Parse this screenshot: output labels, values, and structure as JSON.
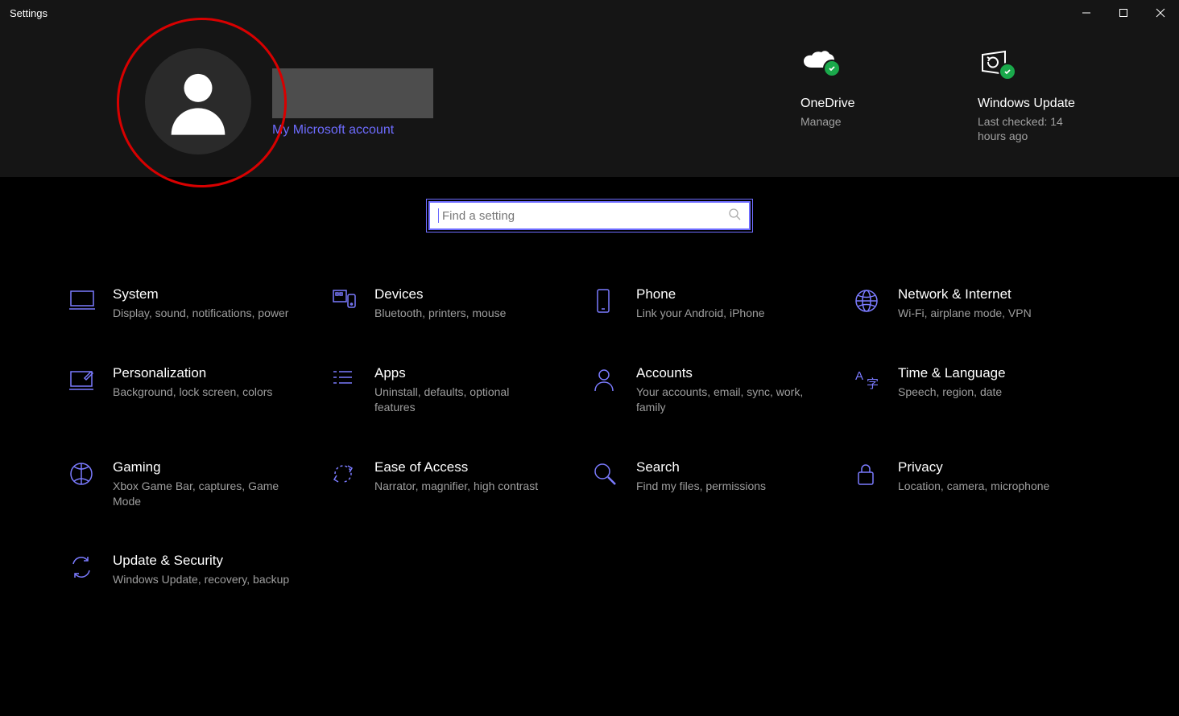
{
  "window": {
    "title": "Settings"
  },
  "profile": {
    "name_redacted": true,
    "account_link_label": "My Microsoft account"
  },
  "status": {
    "onedrive": {
      "title": "OneDrive",
      "subtitle": "Manage"
    },
    "update": {
      "title": "Windows Update",
      "subtitle": "Last checked: 14 hours ago"
    }
  },
  "search": {
    "placeholder": "Find a setting"
  },
  "categories": [
    {
      "id": "system",
      "title": "System",
      "desc": "Display, sound, notifications, power"
    },
    {
      "id": "devices",
      "title": "Devices",
      "desc": "Bluetooth, printers, mouse"
    },
    {
      "id": "phone",
      "title": "Phone",
      "desc": "Link your Android, iPhone"
    },
    {
      "id": "network",
      "title": "Network & Internet",
      "desc": "Wi-Fi, airplane mode, VPN"
    },
    {
      "id": "personalization",
      "title": "Personalization",
      "desc": "Background, lock screen, colors"
    },
    {
      "id": "apps",
      "title": "Apps",
      "desc": "Uninstall, defaults, optional features"
    },
    {
      "id": "accounts",
      "title": "Accounts",
      "desc": "Your accounts, email, sync, work, family"
    },
    {
      "id": "time",
      "title": "Time & Language",
      "desc": "Speech, region, date"
    },
    {
      "id": "gaming",
      "title": "Gaming",
      "desc": "Xbox Game Bar, captures, Game Mode"
    },
    {
      "id": "ease",
      "title": "Ease of Access",
      "desc": "Narrator, magnifier, high contrast"
    },
    {
      "id": "search",
      "title": "Search",
      "desc": "Find my files, permissions"
    },
    {
      "id": "privacy",
      "title": "Privacy",
      "desc": "Location, camera, microphone"
    },
    {
      "id": "update",
      "title": "Update & Security",
      "desc": "Windows Update, recovery, backup"
    }
  ]
}
